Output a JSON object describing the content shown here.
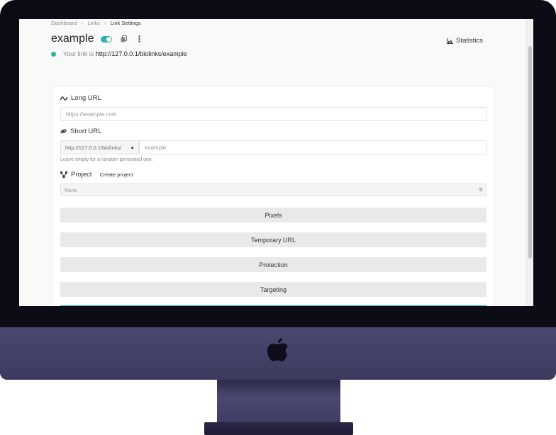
{
  "breadcrumb": [
    {
      "label": "Dashboard"
    },
    {
      "label": "Links"
    },
    {
      "label": "Link Settings"
    }
  ],
  "breadcrumb_separator": "›",
  "header": {
    "title": "example",
    "toggle_on": true,
    "statistics_label": "Statistics"
  },
  "status": {
    "prefix": "Your link is",
    "url": "http://127.0.0.1/biolinks/example"
  },
  "form": {
    "long_url": {
      "label": "Long URL",
      "placeholder": "https://example.com"
    },
    "short_url": {
      "label": "Short URL",
      "prefix_value": "http://127.0.0.1/biolinks/",
      "placeholder": "example",
      "help": "Leave empty for a random generated one."
    },
    "project": {
      "label": "Project",
      "create_label": "Create project",
      "selected": "None"
    },
    "sections": [
      {
        "label": "Pixels"
      },
      {
        "label": "Temporary URL"
      },
      {
        "label": "Protection"
      },
      {
        "label": "Targeting"
      }
    ]
  },
  "colors": {
    "accent": "#2bb5a3",
    "bezel": "#0c0c16",
    "chin": "#4a4870"
  }
}
